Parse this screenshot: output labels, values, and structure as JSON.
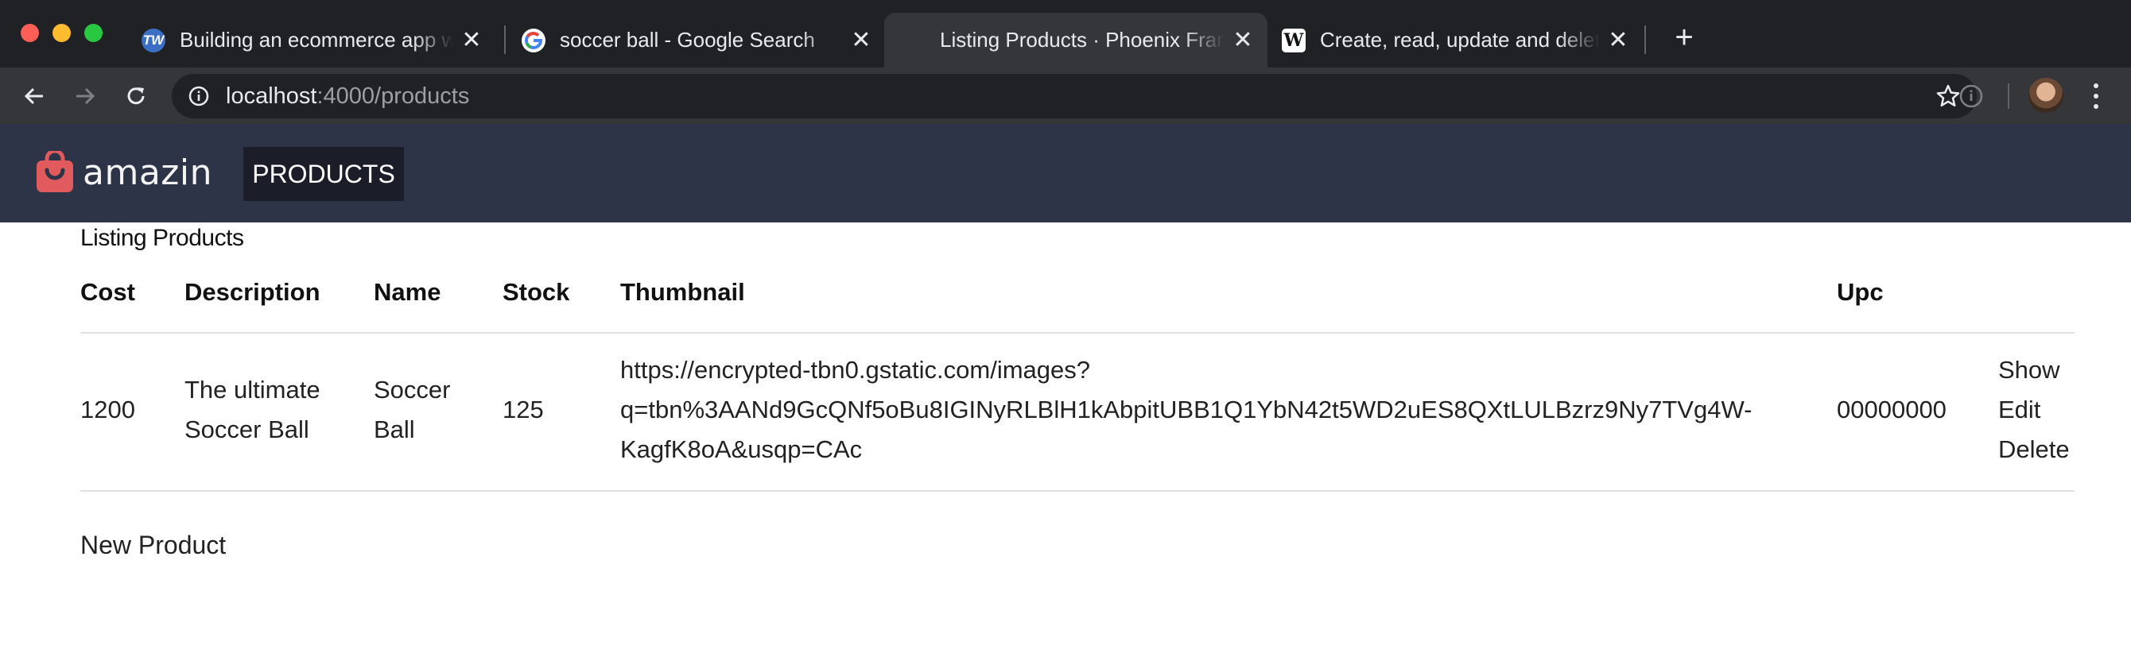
{
  "browser": {
    "tabs": [
      {
        "title": "Building an ecommerce app with",
        "favicon": "tw-icon",
        "active": false
      },
      {
        "title": "soccer ball - Google Search",
        "favicon": "google-icon",
        "active": false
      },
      {
        "title": "Listing Products · Phoenix Framework",
        "favicon": "none",
        "active": true
      },
      {
        "title": "Create, read, update and delete",
        "favicon": "wikipedia-icon",
        "active": false
      }
    ],
    "new_tab_label": "+",
    "close_glyph": "✕",
    "url_host": "localhost",
    "url_rest": ":4000/products"
  },
  "app": {
    "brand": "amazin",
    "brand_color": "#e05a5e",
    "header_color": "#2e3447",
    "nav_products": "PRODUCTS"
  },
  "page": {
    "title": "Listing Products",
    "columns": [
      "Cost",
      "Description",
      "Name",
      "Stock",
      "Thumbnail",
      "Upc"
    ],
    "rows": [
      {
        "cost": "1200",
        "description_lines": [
          "The ultimate",
          "Soccer Ball"
        ],
        "name_lines": [
          "Soccer",
          "Ball"
        ],
        "stock": "125",
        "thumbnail_lines": [
          "https://encrypted-tbn0.gstatic.com/images?",
          "q=tbn%3AANd9GcQNf5oBu8IGINyRLBlH1kAbpitUBB1Q1YbN42t5WD2uES8QXtLULBzrz9Ny7TVg4W-",
          "KagfK8oA&usqp=CAc"
        ],
        "upc": "00000000",
        "actions": [
          "Show",
          "Edit",
          "Delete"
        ]
      }
    ],
    "new_link": "New Product"
  }
}
